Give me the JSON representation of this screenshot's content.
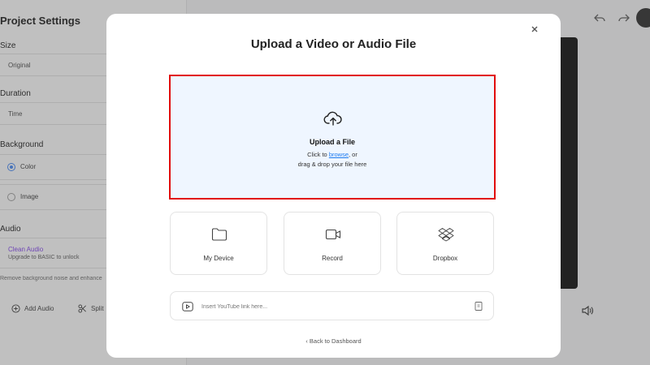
{
  "sidebar": {
    "title": "Project Settings",
    "size": {
      "label": "Size",
      "value": "Original"
    },
    "duration": {
      "label": "Duration",
      "value": "Time"
    },
    "background": {
      "label": "Background",
      "options": [
        {
          "label": "Color",
          "checked": true
        },
        {
          "label": "Image",
          "checked": false
        }
      ]
    },
    "audio": {
      "label": "Audio",
      "clean_audio_title": "Clean Audio",
      "clean_audio_sub": "Upgrade to BASIC to unlock",
      "description": "Remove background noise and enhance"
    }
  },
  "toolbar": {
    "add_audio": "Add Audio",
    "split": "Split"
  },
  "modal": {
    "title": "Upload a Video or Audio File",
    "dropzone": {
      "title": "Upload a File",
      "line1_prefix": "Click to ",
      "browse": "browse",
      "line1_suffix": ", or",
      "line2": "drag & drop your file here"
    },
    "sources": [
      {
        "label": "My Device",
        "icon": "folder-icon"
      },
      {
        "label": "Record",
        "icon": "camera-icon"
      },
      {
        "label": "Dropbox",
        "icon": "dropbox-icon"
      }
    ],
    "youtube_placeholder": "Insert YouTube link here...",
    "back_link": "Back to Dashboard"
  },
  "colors": {
    "dropzone_bg": "#eff6ff",
    "dropzone_border": "#e10d0d",
    "link": "#1d7bf0",
    "accent_purple": "#7c3aed"
  }
}
